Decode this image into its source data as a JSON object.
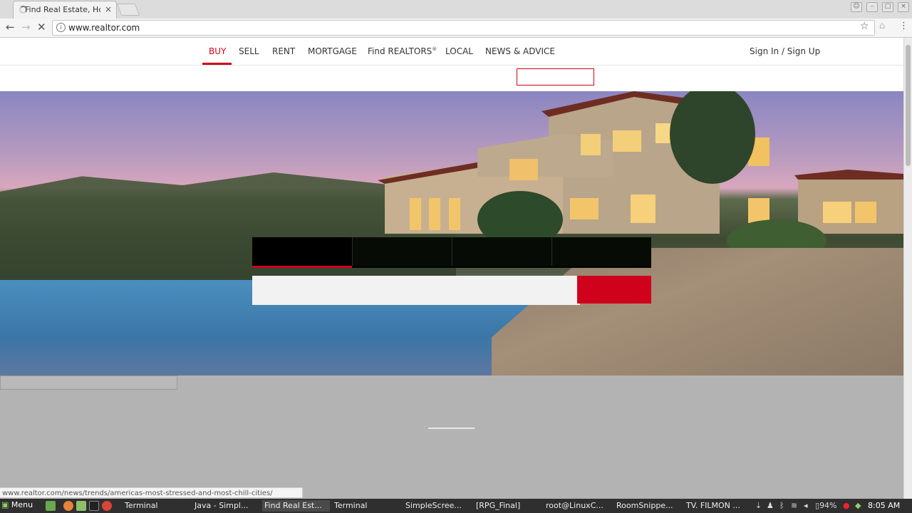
{
  "browser": {
    "tab_title": "Find Real Estate, Hom",
    "tab_close": "×",
    "url": "www.realtor.com",
    "status_url": "www.realtor.com/news/trends/americas-most-stressed-and-most-chill-cities/"
  },
  "site": {
    "nav": [
      "BUY",
      "SELL",
      "RENT",
      "MORTGAGE",
      "Find REALTORS",
      "LOCAL",
      "NEWS & ADVICE"
    ],
    "registered_mark": "®",
    "signin": "Sign In / Sign Up",
    "accent_color": "#d0021b"
  },
  "taskbar": {
    "menu_label": "Menu",
    "tasks": [
      "Terminal",
      "Java - Simpl...",
      "Find Real Est...",
      "Terminal",
      "SimpleScree...",
      "[RPG_Final]",
      "root@LinuxC...",
      "RoomSnippe...",
      "TV. FILMON ..."
    ],
    "battery": "94%",
    "clock": "8:05 AM"
  },
  "icons": [
    "back-arrow-icon",
    "forward-arrow-icon",
    "stop-icon",
    "info-icon",
    "star-icon",
    "menu-icon",
    "spinner-icon"
  ]
}
